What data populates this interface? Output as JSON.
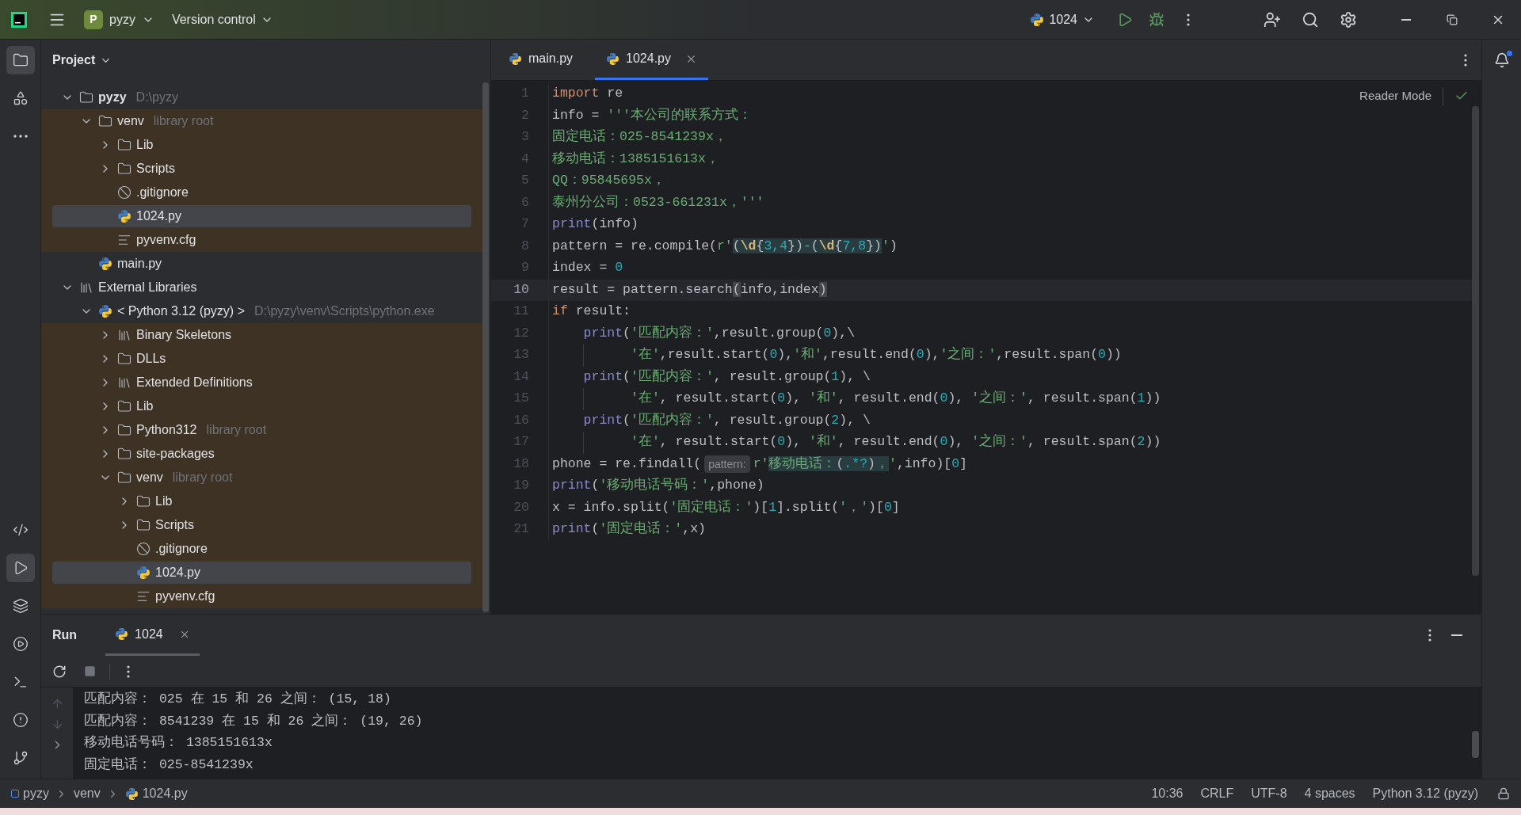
{
  "title_bar": {
    "project_badge": "P",
    "project": "pyzy",
    "vcs": "Version control",
    "run_config": "1024"
  },
  "tool_strip_top": [
    {
      "kind": "project",
      "selected": true
    },
    {
      "kind": "structure",
      "selected": false
    },
    {
      "kind": "more",
      "selected": false
    }
  ],
  "tool_strip_bottom": [
    {
      "kind": "python_console",
      "selected": false
    },
    {
      "kind": "run",
      "selected": true
    },
    {
      "kind": "layers",
      "selected": false
    },
    {
      "kind": "services",
      "selected": false
    },
    {
      "kind": "terminal",
      "selected": false
    },
    {
      "kind": "problems",
      "selected": false
    },
    {
      "kind": "git",
      "selected": false
    }
  ],
  "project_panel": {
    "title": "Project",
    "tree": [
      {
        "label": "pyzy",
        "note": "D:\\pyzy",
        "kind": "folder",
        "expanded": true,
        "selected": false,
        "library": false,
        "bold": true,
        "children": [
          {
            "label": "venv",
            "note": "library root",
            "kind": "folder",
            "expanded": true,
            "selected": false,
            "library": true,
            "children": [
              {
                "label": "Lib",
                "kind": "folder",
                "expanded": false,
                "selected": false,
                "library": true
              },
              {
                "label": "Scripts",
                "kind": "folder",
                "expanded": false,
                "selected": false,
                "library": true
              },
              {
                "label": ".gitignore",
                "kind": "ignore",
                "selected": false,
                "library": true
              },
              {
                "label": "1024.py",
                "kind": "python",
                "selected": true,
                "library": true
              },
              {
                "label": "pyvenv.cfg",
                "kind": "text",
                "selected": false,
                "library": true
              }
            ]
          },
          {
            "label": "main.py",
            "kind": "python",
            "selected": false,
            "library": false
          }
        ]
      },
      {
        "label": "External Libraries",
        "kind": "library",
        "expanded": true,
        "selected": false,
        "library": false,
        "children": [
          {
            "label": "< Python 3.12 (pyzy) >",
            "note": "D:\\pyzy\\venv\\Scripts\\python.exe",
            "kind": "python",
            "expanded": true,
            "selected": false,
            "library": false,
            "children": [
              {
                "label": "Binary Skeletons",
                "kind": "library",
                "expanded": false,
                "selected": false,
                "library": true
              },
              {
                "label": "DLLs",
                "kind": "folder",
                "expanded": false,
                "selected": false,
                "library": true
              },
              {
                "label": "Extended Definitions",
                "kind": "library",
                "expanded": false,
                "selected": false,
                "library": true
              },
              {
                "label": "Lib",
                "kind": "folder",
                "expanded": false,
                "selected": false,
                "library": true
              },
              {
                "label": "Python312",
                "note": "library root",
                "kind": "folder",
                "expanded": false,
                "selected": false,
                "library": true
              },
              {
                "label": "site-packages",
                "kind": "folder",
                "expanded": false,
                "selected": false,
                "library": true
              },
              {
                "label": "venv",
                "note": "library root",
                "kind": "folder",
                "expanded": true,
                "selected": false,
                "library": true,
                "children": [
                  {
                    "label": "Lib",
                    "kind": "folder",
                    "expanded": false,
                    "selected": false,
                    "library": true
                  },
                  {
                    "label": "Scripts",
                    "kind": "folder",
                    "expanded": false,
                    "selected": false,
                    "library": true
                  },
                  {
                    "label": ".gitignore",
                    "kind": "ignore",
                    "selected": false,
                    "library": true
                  },
                  {
                    "label": "1024.py",
                    "kind": "python",
                    "selected": true,
                    "library": true
                  },
                  {
                    "label": "pyvenv.cfg",
                    "kind": "text",
                    "selected": false,
                    "library": true
                  }
                ]
              }
            ]
          }
        ]
      }
    ]
  },
  "editor": {
    "tabs": [
      {
        "label": "main.py",
        "selected": false,
        "closable": false
      },
      {
        "label": "1024.py",
        "selected": true,
        "closable": true
      }
    ],
    "reader_mode": "Reader Mode",
    "lines": [
      {
        "number": "1",
        "current": false,
        "kind": "top",
        "tokens": [
          {
            "t": "import",
            "kind": "kw"
          },
          {
            "t": " re",
            "kind": "plain"
          }
        ]
      },
      {
        "number": "2",
        "current": false,
        "kind": "top",
        "tokens": [
          {
            "t": "info = ",
            "kind": "plain"
          },
          {
            "t": "'''本公司的联系方式：",
            "kind": "str"
          }
        ]
      },
      {
        "number": "3",
        "current": false,
        "kind": "top",
        "tokens": [
          {
            "t": "固定电话：025-8541239x，",
            "kind": "str"
          }
        ]
      },
      {
        "number": "4",
        "current": false,
        "kind": "top",
        "tokens": [
          {
            "t": "移动电话：1385151613x，",
            "kind": "str"
          }
        ]
      },
      {
        "number": "5",
        "current": false,
        "kind": "top",
        "tokens": [
          {
            "t": "QQ：95845695x，",
            "kind": "str"
          }
        ]
      },
      {
        "number": "6",
        "current": false,
        "kind": "top",
        "tokens": [
          {
            "t": "泰州分公司：0523-661231x，'''",
            "kind": "str"
          }
        ]
      },
      {
        "number": "7",
        "current": false,
        "kind": "top",
        "tokens": [
          {
            "t": "print",
            "kind": "builtin"
          },
          {
            "t": "(info)",
            "kind": "plain"
          }
        ]
      },
      {
        "number": "8",
        "current": false,
        "kind": "top",
        "tokens": [
          {
            "t": "pattern = re.compile(",
            "kind": "plain"
          },
          {
            "t": "r'",
            "kind": "str"
          },
          {
            "t": "(",
            "kind": "rxp_hl"
          },
          {
            "t": "\\d",
            "kind": "rx_hl"
          },
          {
            "t": "{",
            "kind": "rxp_hl"
          },
          {
            "t": "3,4",
            "kind": "num_hl"
          },
          {
            "t": "})",
            "kind": "rxp_hl"
          },
          {
            "t": "-",
            "kind": "str_hl"
          },
          {
            "t": "(",
            "kind": "rxp_hl"
          },
          {
            "t": "\\d",
            "kind": "rx_hl"
          },
          {
            "t": "{",
            "kind": "rxp_hl"
          },
          {
            "t": "7,8",
            "kind": "num_hl"
          },
          {
            "t": "})",
            "kind": "rxp_hl"
          },
          {
            "t": "'",
            "kind": "str"
          },
          {
            "t": ")",
            "kind": "plain"
          }
        ]
      },
      {
        "number": "9",
        "current": false,
        "kind": "top",
        "tokens": [
          {
            "t": "index = ",
            "kind": "plain"
          },
          {
            "t": "0",
            "kind": "num"
          }
        ]
      },
      {
        "number": "10",
        "current": true,
        "kind": "top",
        "tokens": [
          {
            "t": "result = pattern.search",
            "kind": "plain"
          },
          {
            "t": "(",
            "kind": "brace_hl"
          },
          {
            "t": "info,index",
            "kind": "plain"
          },
          {
            "t": ")",
            "kind": "brace_hl"
          }
        ]
      },
      {
        "number": "11",
        "current": false,
        "kind": "top",
        "tokens": [
          {
            "t": "if",
            "kind": "kw"
          },
          {
            "t": " result:",
            "kind": "plain"
          }
        ]
      },
      {
        "number": "12",
        "current": false,
        "kind": "block",
        "tokens": [
          {
            "t": "print",
            "kind": "builtin"
          },
          {
            "t": "(",
            "kind": "plain"
          },
          {
            "t": "'匹配内容：'",
            "kind": "str"
          },
          {
            "t": ",result.group(",
            "kind": "plain"
          },
          {
            "t": "0",
            "kind": "num"
          },
          {
            "t": "),\\",
            "kind": "plain"
          }
        ]
      },
      {
        "number": "13",
        "current": false,
        "kind": "continuation",
        "tokens": [
          {
            "t": "'在'",
            "kind": "str"
          },
          {
            "t": ",result.start(",
            "kind": "plain"
          },
          {
            "t": "0",
            "kind": "num"
          },
          {
            "t": "),",
            "kind": "plain"
          },
          {
            "t": "'和'",
            "kind": "str"
          },
          {
            "t": ",result.end(",
            "kind": "plain"
          },
          {
            "t": "0",
            "kind": "num"
          },
          {
            "t": "),",
            "kind": "plain"
          },
          {
            "t": "'之间：'",
            "kind": "str"
          },
          {
            "t": ",result.span(",
            "kind": "plain"
          },
          {
            "t": "0",
            "kind": "num"
          },
          {
            "t": "))",
            "kind": "plain"
          }
        ]
      },
      {
        "number": "14",
        "current": false,
        "kind": "block",
        "tokens": [
          {
            "t": "print",
            "kind": "builtin"
          },
          {
            "t": "(",
            "kind": "plain"
          },
          {
            "t": "'匹配内容：'",
            "kind": "str"
          },
          {
            "t": ", result.group(",
            "kind": "plain"
          },
          {
            "t": "1",
            "kind": "num"
          },
          {
            "t": "), \\",
            "kind": "plain"
          }
        ]
      },
      {
        "number": "15",
        "current": false,
        "kind": "continuation",
        "tokens": [
          {
            "t": "'在'",
            "kind": "str"
          },
          {
            "t": ", result.start(",
            "kind": "plain"
          },
          {
            "t": "0",
            "kind": "num"
          },
          {
            "t": "), ",
            "kind": "plain"
          },
          {
            "t": "'和'",
            "kind": "str"
          },
          {
            "t": ", result.end(",
            "kind": "plain"
          },
          {
            "t": "0",
            "kind": "num"
          },
          {
            "t": "), ",
            "kind": "plain"
          },
          {
            "t": "'之间：'",
            "kind": "str"
          },
          {
            "t": ", result.span(",
            "kind": "plain"
          },
          {
            "t": "1",
            "kind": "num"
          },
          {
            "t": "))",
            "kind": "plain"
          }
        ]
      },
      {
        "number": "16",
        "current": false,
        "kind": "block",
        "tokens": [
          {
            "t": "print",
            "kind": "builtin"
          },
          {
            "t": "(",
            "kind": "plain"
          },
          {
            "t": "'匹配内容：'",
            "kind": "str"
          },
          {
            "t": ", result.group(",
            "kind": "plain"
          },
          {
            "t": "2",
            "kind": "num"
          },
          {
            "t": "), \\",
            "kind": "plain"
          }
        ]
      },
      {
        "number": "17",
        "current": false,
        "kind": "continuation",
        "tokens": [
          {
            "t": "'在'",
            "kind": "str"
          },
          {
            "t": ", result.start(",
            "kind": "plain"
          },
          {
            "t": "0",
            "kind": "num"
          },
          {
            "t": "), ",
            "kind": "plain"
          },
          {
            "t": "'和'",
            "kind": "str"
          },
          {
            "t": ", result.end(",
            "kind": "plain"
          },
          {
            "t": "0",
            "kind": "num"
          },
          {
            "t": "), ",
            "kind": "plain"
          },
          {
            "t": "'之间：'",
            "kind": "str"
          },
          {
            "t": ", result.span(",
            "kind": "plain"
          },
          {
            "t": "2",
            "kind": "num"
          },
          {
            "t": "))",
            "kind": "plain"
          }
        ]
      },
      {
        "number": "18",
        "current": false,
        "kind": "top",
        "tokens": [
          {
            "t": "phone = re.findall(",
            "kind": "plain"
          },
          {
            "t": "pattern:",
            "kind": "hint"
          },
          {
            "t": "r'",
            "kind": "str"
          },
          {
            "t": "移动电话：",
            "kind": "str_hl"
          },
          {
            "t": "(",
            "kind": "rxp_hl"
          },
          {
            "t": ".*?",
            "kind": "num_hl"
          },
          {
            "t": ")",
            "kind": "rxp_hl"
          },
          {
            "t": "，",
            "kind": "str_hl"
          },
          {
            "t": "'",
            "kind": "str"
          },
          {
            "t": ",info)[",
            "kind": "plain"
          },
          {
            "t": "0",
            "kind": "num"
          },
          {
            "t": "]",
            "kind": "plain"
          }
        ]
      },
      {
        "number": "19",
        "current": false,
        "kind": "top",
        "tokens": [
          {
            "t": "print",
            "kind": "builtin"
          },
          {
            "t": "(",
            "kind": "plain"
          },
          {
            "t": "'移动电话号码：'",
            "kind": "str"
          },
          {
            "t": ",phone)",
            "kind": "plain"
          }
        ]
      },
      {
        "number": "20",
        "current": false,
        "kind": "top",
        "tokens": [
          {
            "t": "x = info.split(",
            "kind": "plain"
          },
          {
            "t": "'固定电话：'",
            "kind": "str"
          },
          {
            "t": ")[",
            "kind": "plain"
          },
          {
            "t": "1",
            "kind": "num"
          },
          {
            "t": "].split(",
            "kind": "plain"
          },
          {
            "t": "'，'",
            "kind": "str"
          },
          {
            "t": ")[",
            "kind": "plain"
          },
          {
            "t": "0",
            "kind": "num"
          },
          {
            "t": "]",
            "kind": "plain"
          }
        ]
      },
      {
        "number": "21",
        "current": false,
        "kind": "top",
        "tokens": [
          {
            "t": "print",
            "kind": "builtin"
          },
          {
            "t": "(",
            "kind": "plain"
          },
          {
            "t": "'固定电话：'",
            "kind": "str"
          },
          {
            "t": ",x)",
            "kind": "plain"
          }
        ]
      }
    ]
  },
  "run_panel": {
    "title": "Run",
    "tabs": [
      {
        "label": "1024",
        "selected": true
      }
    ],
    "output": [
      "匹配内容： 025 在 15 和 26 之间： (15, 18)",
      "匹配内容： 8541239 在 15 和 26 之间： (19, 26)",
      "移动电话号码： 1385151613x",
      "固定电话： 025-8541239x"
    ]
  },
  "status_bar": {
    "breadcrumbs": [
      {
        "label": "pyzy",
        "kind": "module"
      },
      {
        "label": "venv",
        "kind": "none"
      },
      {
        "label": "1024.py",
        "kind": "python"
      }
    ],
    "items": [
      "10:36",
      "CRLF",
      "UTF-8",
      "4 spaces",
      "Python 3.12 (pyzy)"
    ]
  }
}
